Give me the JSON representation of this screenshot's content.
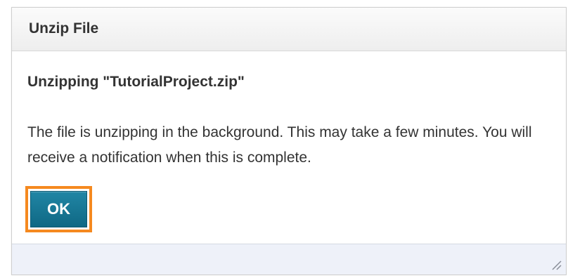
{
  "dialog": {
    "title": "Unzip File",
    "heading": "Unzipping \"TutorialProject.zip\"",
    "message": "The file is unzipping in the background. This may take a few minutes. You will receive a notification when this is complete.",
    "ok_label": "OK"
  },
  "icons": {
    "resize": "resize-grip-icon"
  },
  "colors": {
    "button_primary": "#1a7896",
    "focus_outline": "#f5891f",
    "footer_background": "#eef1f9"
  }
}
